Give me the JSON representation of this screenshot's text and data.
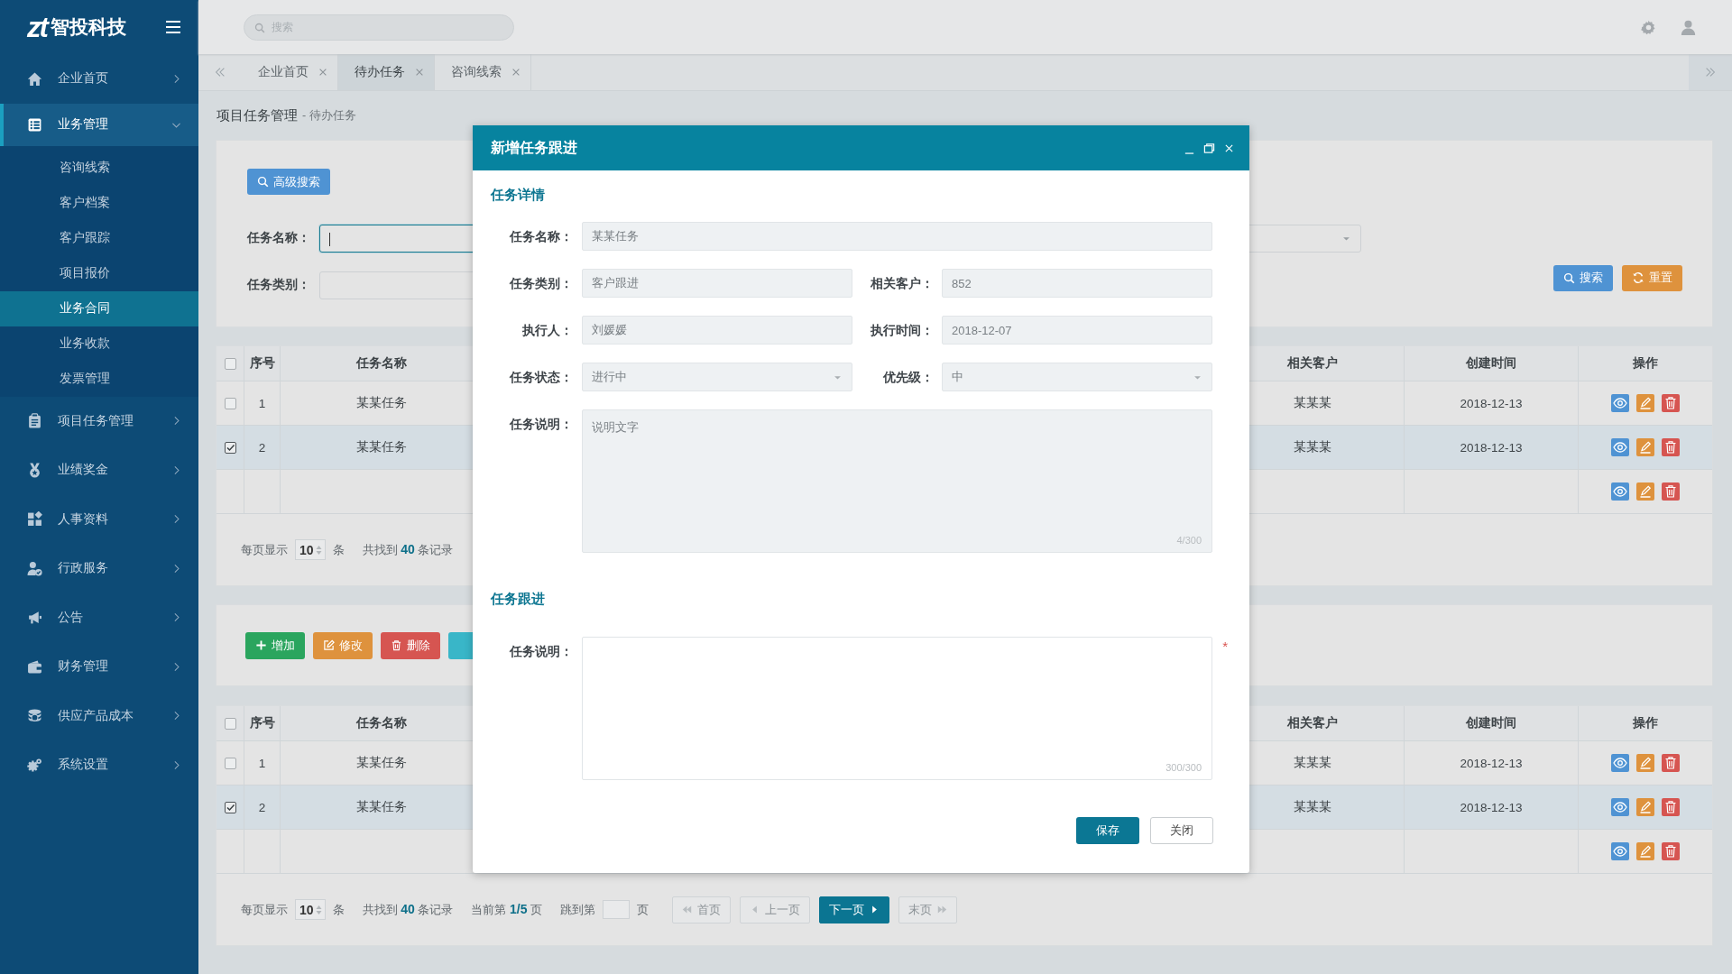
{
  "sidebar": {
    "logo_mark": "zt",
    "brand": "智投科技",
    "items": [
      {
        "label": "企业首页",
        "expanded": false
      },
      {
        "label": "业务管理",
        "expanded": true,
        "children": [
          {
            "label": "咨询线索",
            "selected": false
          },
          {
            "label": "客户档案",
            "selected": false
          },
          {
            "label": "客户跟踪",
            "selected": false
          },
          {
            "label": "项目报价",
            "selected": false
          },
          {
            "label": "业务合同",
            "selected": true
          },
          {
            "label": "业务收款",
            "selected": false
          },
          {
            "label": "发票管理",
            "selected": false
          }
        ]
      },
      {
        "label": "项目任务管理",
        "expanded": false
      },
      {
        "label": "业绩奖金",
        "expanded": false
      },
      {
        "label": "人事资料",
        "expanded": false
      },
      {
        "label": "行政服务",
        "expanded": false
      },
      {
        "label": "公告",
        "expanded": false
      },
      {
        "label": "财务管理",
        "expanded": false
      },
      {
        "label": "供应产品成本",
        "expanded": false
      },
      {
        "label": "系统设置",
        "expanded": false
      }
    ]
  },
  "topbar": {
    "search": {
      "placeholder": "搜索"
    }
  },
  "tabs": [
    {
      "label": "企业首页",
      "selected": false
    },
    {
      "label": "待办任务",
      "selected": true
    },
    {
      "label": "咨询线索",
      "selected": false
    }
  ],
  "breadcrumb": {
    "section": "项目任务管理",
    "page": "- 待办任务"
  },
  "filter": {
    "advanced_button": "高级搜索",
    "fields": [
      {
        "label": "任务名称：",
        "focused": true
      },
      {
        "label": "任务类别：",
        "focused": false
      }
    ],
    "buttons": [
      {
        "label": "搜索",
        "kind": "search"
      },
      {
        "label": "重置",
        "kind": "reset"
      }
    ]
  },
  "tables": [
    {
      "header_checked": false,
      "columns": [
        "序号",
        "任务名称",
        "相关客户",
        "创建时间",
        "操作"
      ],
      "rows": [
        {
          "kind": "data",
          "selected": false,
          "cells": [
            "1",
            "某某任务",
            "某某某",
            "2018-12-13"
          ]
        },
        {
          "kind": "data",
          "selected": true,
          "cells": [
            "2",
            "某某任务",
            "某某某",
            "2018-12-13"
          ]
        },
        {
          "kind": "blank"
        }
      ],
      "pager": {
        "per_page_label": "每页显示",
        "per_page": "10",
        "per_page_unit": "条",
        "total": "共找到 **40** 条记录"
      }
    },
    {
      "header_checked": false,
      "columns": [
        "序号",
        "任务名称",
        "相关客户",
        "创建时间",
        "操作"
      ],
      "rows": [
        {
          "kind": "data",
          "selected": false,
          "cells": [
            "1",
            "某某任务",
            "某某某",
            "2018-12-13"
          ]
        },
        {
          "kind": "data",
          "selected": true,
          "cells": [
            "2",
            "某某任务",
            "某某某",
            "2018-12-13"
          ]
        },
        {
          "kind": "blank"
        }
      ],
      "pager": {
        "per_page_label": "每页显示",
        "per_page": "10",
        "per_page_unit": "条",
        "total": "共找到 **40** 条记录",
        "current": "当前第 **1/5** 页",
        "jump_label": "跳到第",
        "jump_unit": "页",
        "buttons": [
          {
            "label": "首页",
            "kind": "first"
          },
          {
            "label": "上一页",
            "kind": "prev"
          },
          {
            "label": "下一页",
            "kind": "next"
          },
          {
            "label": "末页",
            "kind": "last"
          }
        ]
      }
    }
  ],
  "toolbar": {
    "buttons": [
      {
        "label": "增加",
        "kind": "add"
      },
      {
        "label": "修改",
        "kind": "edit"
      },
      {
        "label": "删除",
        "kind": "delete"
      },
      {
        "kind": "info"
      }
    ]
  },
  "modal": {
    "title": "新增任务跟进",
    "sections": [
      {
        "title": "任务详情",
        "rows": [
          [
            {
              "kind": "text",
              "label": "任务名称：",
              "value": "某某任务",
              "disabled": true
            }
          ],
          [
            {
              "kind": "text",
              "label": "任务类别：",
              "value": "客户跟进",
              "disabled": true
            },
            {
              "kind": "text",
              "label": "相关客户：",
              "value": "852",
              "disabled": true
            }
          ],
          [
            {
              "kind": "text",
              "label": "执行人：",
              "value": "刘媛媛",
              "disabled": true
            },
            {
              "kind": "text",
              "label": "执行时间：",
              "value": "2018-12-07",
              "disabled": true
            }
          ],
          [
            {
              "kind": "select",
              "label": "任务状态：",
              "value": "进行中",
              "disabled": true
            },
            {
              "kind": "select",
              "label": "优先级：",
              "value": "中",
              "disabled": true
            }
          ],
          [
            {
              "kind": "textarea",
              "label": "任务说明：",
              "value": "说明文字",
              "counter": "4/300",
              "disabled": true
            }
          ]
        ]
      },
      {
        "title": "任务跟进",
        "rows": [
          [
            {
              "kind": "textarea",
              "label": "任务说明：",
              "counter": "300/300",
              "disabled": false,
              "required_mark": "*"
            }
          ]
        ]
      }
    ],
    "actions": [
      {
        "label": "保存",
        "kind": "primary"
      },
      {
        "label": "关闭",
        "kind": "default"
      }
    ]
  }
}
